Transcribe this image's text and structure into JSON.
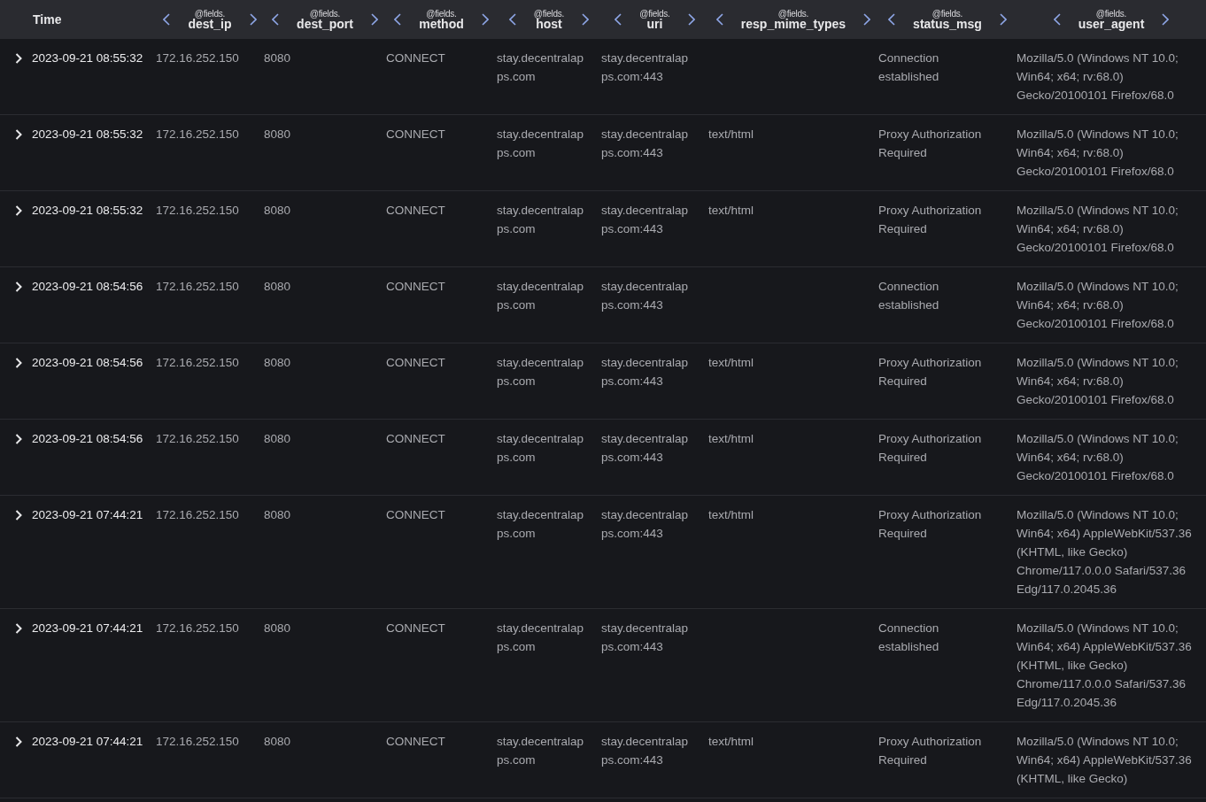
{
  "columns": [
    {
      "kind": "plain",
      "label": "Time"
    },
    {
      "kind": "field",
      "prefix": "@fields.",
      "label": "dest_ip"
    },
    {
      "kind": "field",
      "prefix": "@fields.",
      "label": "dest_port"
    },
    {
      "kind": "field",
      "prefix": "@fields.",
      "label": "method"
    },
    {
      "kind": "field",
      "prefix": "@fields.",
      "label": "host"
    },
    {
      "kind": "field",
      "prefix": "@fields.",
      "label": "uri"
    },
    {
      "kind": "field",
      "prefix": "@fields.",
      "label": "resp_mime_types"
    },
    {
      "kind": "field",
      "prefix": "@fields.",
      "label": "status_msg"
    },
    {
      "kind": "field",
      "prefix": "@fields.",
      "label": "user_agent"
    }
  ],
  "rows": [
    {
      "expanded": false,
      "cells": [
        "2023-09-21 08:55:32",
        "172.16.252.150",
        "8080",
        "CONNECT",
        "stay.decentralapps.com",
        "stay.decentralapps.com:443",
        "",
        "Connection established",
        "Mozilla/5.0 (Windows NT 10.0; Win64; x64; rv:68.0) Gecko/20100101 Firefox/68.0"
      ]
    },
    {
      "expanded": false,
      "cells": [
        "2023-09-21 08:55:32",
        "172.16.252.150",
        "8080",
        "CONNECT",
        "stay.decentralapps.com",
        "stay.decentralapps.com:443",
        "text/html",
        "Proxy Authorization Required",
        "Mozilla/5.0 (Windows NT 10.0; Win64; x64; rv:68.0) Gecko/20100101 Firefox/68.0"
      ]
    },
    {
      "expanded": false,
      "cells": [
        "2023-09-21 08:55:32",
        "172.16.252.150",
        "8080",
        "CONNECT",
        "stay.decentralapps.com",
        "stay.decentralapps.com:443",
        "text/html",
        "Proxy Authorization Required",
        "Mozilla/5.0 (Windows NT 10.0; Win64; x64; rv:68.0) Gecko/20100101 Firefox/68.0"
      ]
    },
    {
      "expanded": false,
      "cells": [
        "2023-09-21 08:54:56",
        "172.16.252.150",
        "8080",
        "CONNECT",
        "stay.decentralapps.com",
        "stay.decentralapps.com:443",
        "",
        "Connection established",
        "Mozilla/5.0 (Windows NT 10.0; Win64; x64; rv:68.0) Gecko/20100101 Firefox/68.0"
      ]
    },
    {
      "expanded": false,
      "cells": [
        "2023-09-21 08:54:56",
        "172.16.252.150",
        "8080",
        "CONNECT",
        "stay.decentralapps.com",
        "stay.decentralapps.com:443",
        "text/html",
        "Proxy Authorization Required",
        "Mozilla/5.0 (Windows NT 10.0; Win64; x64; rv:68.0) Gecko/20100101 Firefox/68.0"
      ]
    },
    {
      "expanded": false,
      "cells": [
        "2023-09-21 08:54:56",
        "172.16.252.150",
        "8080",
        "CONNECT",
        "stay.decentralapps.com",
        "stay.decentralapps.com:443",
        "text/html",
        "Proxy Authorization Required",
        "Mozilla/5.0 (Windows NT 10.0; Win64; x64; rv:68.0) Gecko/20100101 Firefox/68.0"
      ]
    },
    {
      "expanded": false,
      "cells": [
        "2023-09-21 07:44:21",
        "172.16.252.150",
        "8080",
        "CONNECT",
        "stay.decentralapps.com",
        "stay.decentralapps.com:443",
        "text/html",
        "Proxy Authorization Required",
        "Mozilla/5.0 (Windows NT 10.0; Win64; x64) AppleWebKit/537.36 (KHTML, like Gecko) Chrome/117.0.0.0 Safari/537.36 Edg/117.0.2045.36"
      ]
    },
    {
      "expanded": false,
      "cells": [
        "2023-09-21 07:44:21",
        "172.16.252.150",
        "8080",
        "CONNECT",
        "stay.decentralapps.com",
        "stay.decentralapps.com:443",
        "",
        "Connection established",
        "Mozilla/5.0 (Windows NT 10.0; Win64; x64) AppleWebKit/537.36 (KHTML, like Gecko) Chrome/117.0.0.0 Safari/537.36 Edg/117.0.2045.36"
      ]
    },
    {
      "expanded": false,
      "cells": [
        "2023-09-21 07:44:21",
        "172.16.252.150",
        "8080",
        "CONNECT",
        "stay.decentralapps.com",
        "stay.decentralapps.com:443",
        "text/html",
        "Proxy Authorization Required",
        "Mozilla/5.0 (Windows NT 10.0; Win64; x64) AppleWebKit/537.36 (KHTML, like Gecko)"
      ]
    }
  ]
}
